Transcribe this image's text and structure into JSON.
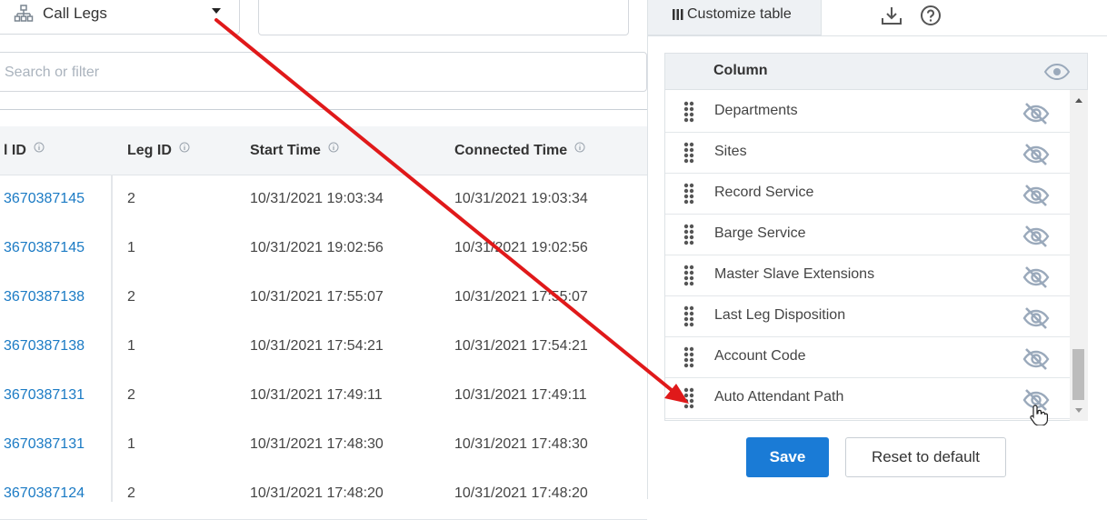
{
  "view_select": {
    "label": "Call Legs"
  },
  "search": {
    "placeholder": "Search or filter",
    "value": ""
  },
  "table": {
    "headers": [
      "l ID",
      "Leg ID",
      "Start Time",
      "Connected Time"
    ],
    "rows": [
      [
        "3670387145",
        "2",
        "10/31/2021 19:03:34",
        "10/31/2021 19:03:34"
      ],
      [
        "3670387145",
        "1",
        "10/31/2021 19:02:56",
        "10/31/2021 19:02:56"
      ],
      [
        "3670387138",
        "2",
        "10/31/2021 17:55:07",
        "10/31/2021 17:55:07"
      ],
      [
        "3670387138",
        "1",
        "10/31/2021 17:54:21",
        "10/31/2021 17:54:21"
      ],
      [
        "3670387131",
        "2",
        "10/31/2021 17:49:11",
        "10/31/2021 17:49:11"
      ],
      [
        "3670387131",
        "1",
        "10/31/2021 17:48:30",
        "10/31/2021 17:48:30"
      ],
      [
        "3670387124",
        "2",
        "10/31/2021 17:48:20",
        "10/31/2021 17:48:20"
      ]
    ]
  },
  "toolbar": {
    "customize_label": "Customize table"
  },
  "customize_panel": {
    "column_header": "Column",
    "columns": [
      "Departments",
      "Sites",
      "Record Service",
      "Barge Service",
      "Master Slave Extensions",
      "Last Leg Disposition",
      "Account Code",
      "Auto Attendant Path"
    ],
    "save_label": "Save",
    "reset_label": "Reset to default"
  },
  "colors": {
    "link": "#1a7ac4",
    "primary_button": "#1a7bd6",
    "annotation_arrow": "#e0191a",
    "hidden_icon": "#9aa9bb"
  }
}
